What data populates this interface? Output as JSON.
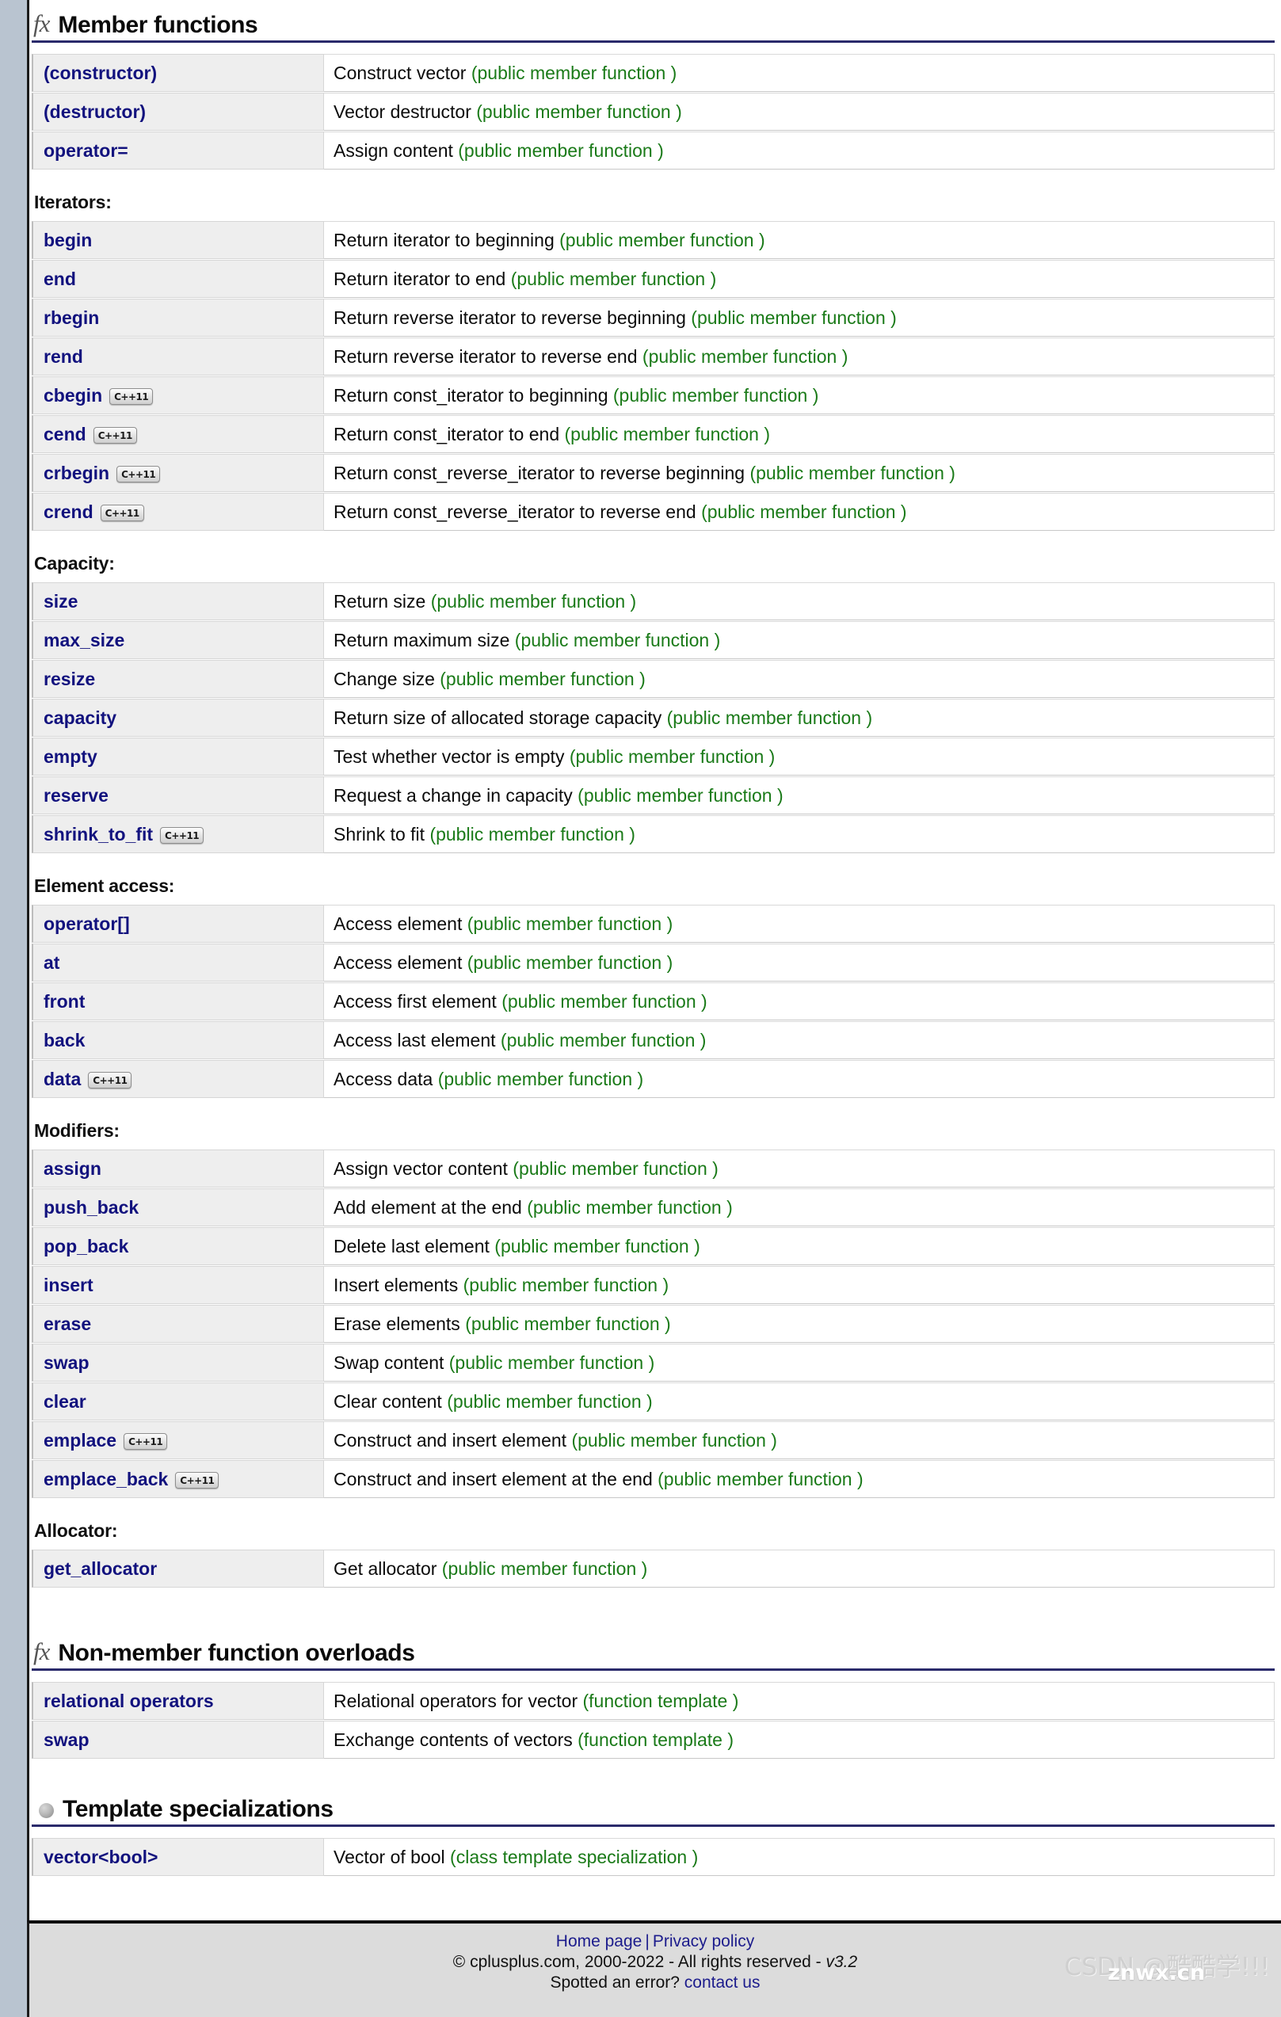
{
  "colors": {
    "link_blue": "#12127e",
    "kind_green": "#1a7a18",
    "heading_rule": "#2a2a6b",
    "page_bg": "#b9c4d0",
    "row_bg": "#eeeeee",
    "footer_bg": "#dcdcdc"
  },
  "sections": [
    {
      "id": "member-functions",
      "icon": "fx-icon",
      "title": "Member functions",
      "groups": [
        {
          "label": null,
          "rows": [
            {
              "name": "(constructor)",
              "badge": null,
              "desc": "Construct vector",
              "kind": "(public member function )"
            },
            {
              "name": "(destructor)",
              "badge": null,
              "desc": "Vector destructor",
              "kind": "(public member function )"
            },
            {
              "name": "operator=",
              "badge": null,
              "desc": "Assign content",
              "kind": "(public member function )"
            }
          ]
        },
        {
          "label": "Iterators:",
          "rows": [
            {
              "name": "begin",
              "badge": null,
              "desc": "Return iterator to beginning",
              "kind": "(public member function )"
            },
            {
              "name": "end",
              "badge": null,
              "desc": "Return iterator to end",
              "kind": "(public member function )"
            },
            {
              "name": "rbegin",
              "badge": null,
              "desc": "Return reverse iterator to reverse beginning",
              "kind": "(public member function )"
            },
            {
              "name": "rend",
              "badge": null,
              "desc": "Return reverse iterator to reverse end",
              "kind": "(public member function )"
            },
            {
              "name": "cbegin",
              "badge": "C++11",
              "desc": "Return const_iterator to beginning",
              "kind": "(public member function )"
            },
            {
              "name": "cend",
              "badge": "C++11",
              "desc": "Return const_iterator to end",
              "kind": "(public member function )"
            },
            {
              "name": "crbegin",
              "badge": "C++11",
              "desc": "Return const_reverse_iterator to reverse beginning",
              "kind": "(public member function )"
            },
            {
              "name": "crend",
              "badge": "C++11",
              "desc": "Return const_reverse_iterator to reverse end",
              "kind": "(public member function )"
            }
          ]
        },
        {
          "label": "Capacity:",
          "rows": [
            {
              "name": "size",
              "badge": null,
              "desc": "Return size",
              "kind": "(public member function )"
            },
            {
              "name": "max_size",
              "badge": null,
              "desc": "Return maximum size",
              "kind": "(public member function )"
            },
            {
              "name": "resize",
              "badge": null,
              "desc": "Change size",
              "kind": "(public member function )"
            },
            {
              "name": "capacity",
              "badge": null,
              "desc": "Return size of allocated storage capacity",
              "kind": "(public member function )"
            },
            {
              "name": "empty",
              "badge": null,
              "desc": "Test whether vector is empty",
              "kind": "(public member function )"
            },
            {
              "name": "reserve",
              "badge": null,
              "desc": "Request a change in capacity",
              "kind": "(public member function )"
            },
            {
              "name": "shrink_to_fit",
              "badge": "C++11",
              "desc": "Shrink to fit",
              "kind": "(public member function )"
            }
          ]
        },
        {
          "label": "Element access:",
          "rows": [
            {
              "name": "operator[]",
              "badge": null,
              "desc": "Access element",
              "kind": "(public member function )"
            },
            {
              "name": "at",
              "badge": null,
              "desc": "Access element",
              "kind": "(public member function )"
            },
            {
              "name": "front",
              "badge": null,
              "desc": "Access first element",
              "kind": "(public member function )"
            },
            {
              "name": "back",
              "badge": null,
              "desc": "Access last element",
              "kind": "(public member function )"
            },
            {
              "name": "data",
              "badge": "C++11",
              "desc": "Access data",
              "kind": "(public member function )"
            }
          ]
        },
        {
          "label": "Modifiers:",
          "rows": [
            {
              "name": "assign",
              "badge": null,
              "desc": "Assign vector content",
              "kind": "(public member function )"
            },
            {
              "name": "push_back",
              "badge": null,
              "desc": "Add element at the end",
              "kind": "(public member function )"
            },
            {
              "name": "pop_back",
              "badge": null,
              "desc": "Delete last element",
              "kind": "(public member function )"
            },
            {
              "name": "insert",
              "badge": null,
              "desc": "Insert elements",
              "kind": "(public member function )"
            },
            {
              "name": "erase",
              "badge": null,
              "desc": "Erase elements",
              "kind": "(public member function )"
            },
            {
              "name": "swap",
              "badge": null,
              "desc": "Swap content",
              "kind": "(public member function )"
            },
            {
              "name": "clear",
              "badge": null,
              "desc": "Clear content",
              "kind": "(public member function )"
            },
            {
              "name": "emplace",
              "badge": "C++11",
              "desc": "Construct and insert element",
              "kind": "(public member function )"
            },
            {
              "name": "emplace_back",
              "badge": "C++11",
              "desc": "Construct and insert element at the end",
              "kind": "(public member function )"
            }
          ]
        },
        {
          "label": "Allocator:",
          "rows": [
            {
              "name": "get_allocator",
              "badge": null,
              "desc": "Get allocator",
              "kind": "(public member function )"
            }
          ]
        }
      ]
    },
    {
      "id": "non-member-function-overloads",
      "icon": "fx-icon",
      "title": "Non-member function overloads",
      "groups": [
        {
          "label": null,
          "rows": [
            {
              "name": "relational operators",
              "badge": null,
              "desc": "Relational operators for vector",
              "kind": "(function template )"
            },
            {
              "name": "swap",
              "badge": null,
              "desc": "Exchange contents of vectors",
              "kind": "(function template )"
            }
          ]
        }
      ]
    },
    {
      "id": "template-specializations",
      "icon": "bullet-icon",
      "title": "Template specializations",
      "groups": [
        {
          "label": null,
          "rows": [
            {
              "name": "vector<bool>",
              "badge": null,
              "desc": "Vector of bool",
              "kind": "(class template specialization )"
            }
          ]
        }
      ]
    }
  ],
  "footer": {
    "home_page": "Home page",
    "separator": "|",
    "privacy_policy": "Privacy policy",
    "copyright_prefix": "© cplusplus.com, 2000-2022 - All rights reserved - ",
    "version": "v3.2",
    "spotted_prefix": "Spotted an error? ",
    "contact_us": "contact us"
  },
  "watermark": {
    "text": "CSDN @酷酷学!!!",
    "overlay": "znwx.cn"
  }
}
